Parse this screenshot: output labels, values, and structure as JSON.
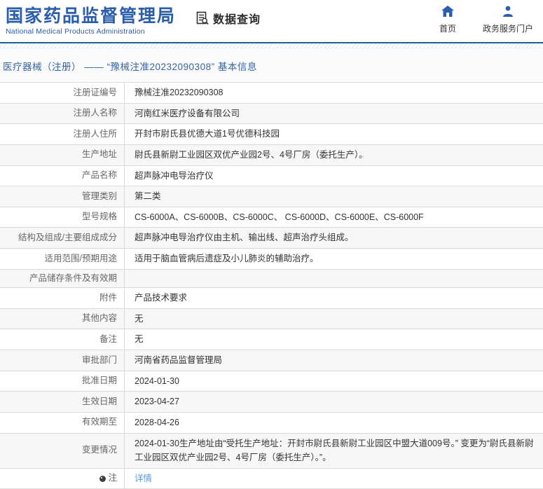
{
  "header": {
    "title": "国家药品监督管理局",
    "subtitle": "National Medical Products Administration",
    "data_query_label": "数据查询",
    "nav": [
      {
        "label": "首页",
        "icon": "home-icon"
      },
      {
        "label": "政务服务门户",
        "icon": "user-icon"
      }
    ]
  },
  "breadcrumb": "医疗器械（注册） —— “豫械注准20232090308” 基本信息",
  "colors": {
    "brand_blue": "#2a5dab",
    "breadcrumb_blue": "#3465a8",
    "link_blue": "#5b9bd5",
    "top_line": "#1f6391",
    "row_shaded": "#f7f7f7",
    "row_border": "#d9d9d9",
    "label_text": "#666666",
    "value_text": "#333333"
  },
  "table": {
    "rows": [
      {
        "label": "注册证编号",
        "value": "豫械注准20232090308"
      },
      {
        "label": "注册人名称",
        "value": "河南红米医疗设备有限公司"
      },
      {
        "label": "注册人住所",
        "value": "开封市尉氏县优德大道1号优德科技园"
      },
      {
        "label": "生产地址",
        "value": "尉氏县新尉工业园区双优产业园2号、4号厂房（委托生产）。"
      },
      {
        "label": "产品名称",
        "value": "超声脉冲电导治疗仪"
      },
      {
        "label": "管理类别",
        "value": "第二类"
      },
      {
        "label": "型号规格",
        "value": "CS-6000A、CS-6000B、CS-6000C、 CS-6000D、CS-6000E、CS-6000F"
      },
      {
        "label": "结构及组成/主要组成成分",
        "value": "超声脉冲电导治疗仪由主机、输出线、超声治疗头组成。"
      },
      {
        "label": "适用范围/预期用途",
        "value": "适用于脑血管病后遗症及小儿肺炎的辅助治疗。"
      },
      {
        "label": "产品储存条件及有效期",
        "value": ""
      },
      {
        "label": "附件",
        "value": "产品技术要求"
      },
      {
        "label": "其他内容",
        "value": "无"
      },
      {
        "label": "备注",
        "value": "无"
      },
      {
        "label": "审批部门",
        "value": "河南省药品监督管理局"
      },
      {
        "label": "批准日期",
        "value": "2024-01-30"
      },
      {
        "label": "生效日期",
        "value": "2023-04-27"
      },
      {
        "label": "有效期至",
        "value": "2028-04-26"
      },
      {
        "label": "变更情况",
        "value": "2024-01-30生产地址由“受托生产地址：开封市尉氏县新尉工业园区中盟大道009号。” 变更为“尉氏县新尉工业园区双优产业园2号、4号厂房（委托生产）。”。"
      },
      {
        "label": "注",
        "value": "详情",
        "link": true,
        "note_icon": true
      }
    ]
  }
}
